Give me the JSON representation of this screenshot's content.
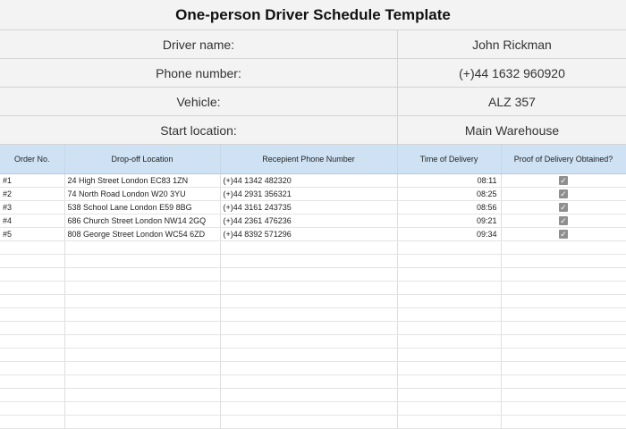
{
  "title": "One-person Driver Schedule Template",
  "info": [
    {
      "label": "Driver name:",
      "value": "John Rickman"
    },
    {
      "label": "Phone number:",
      "value": "(+)44 1632 960920"
    },
    {
      "label": "Vehicle:",
      "value": "ALZ 357"
    },
    {
      "label": "Start location:",
      "value": "Main Warehouse"
    }
  ],
  "columns": [
    "Order No.",
    "Drop-off Location",
    "Recepient Phone Number",
    "Time of Delivery",
    "Proof of Delivery Obtained?"
  ],
  "rows": [
    {
      "order": "#1",
      "location": "24 High Street London EC83 1ZN",
      "phone": "(+)44 1342 482320",
      "time": "08:11",
      "proof": true
    },
    {
      "order": "#2",
      "location": "74 North Road London W20 3YU",
      "phone": "(+)44 2931 356321",
      "time": "08:25",
      "proof": true
    },
    {
      "order": "#3",
      "location": "538 School Lane London E59 8BG",
      "phone": "(+)44 3161 243735",
      "time": "08:56",
      "proof": true
    },
    {
      "order": "#4",
      "location": "686 Church Street London NW14 2GQ",
      "phone": "(+)44 2361 476236",
      "time": "09:21",
      "proof": true
    },
    {
      "order": "#5",
      "location": "808 George Street London WC54 6ZD",
      "phone": "(+)44 8392 571296",
      "time": "09:34",
      "proof": true
    }
  ],
  "icons": {
    "checkbox": "checkbox-checked-icon"
  }
}
